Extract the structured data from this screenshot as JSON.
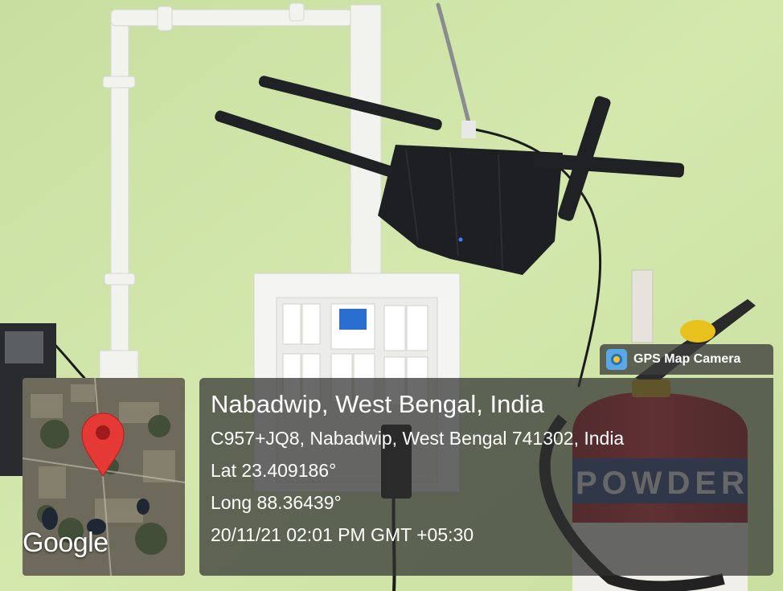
{
  "badge": {
    "app_name": "GPS Map Camera",
    "icon": "camera-map-icon"
  },
  "map": {
    "logo": "Google",
    "pin_icon": "map-pin-icon",
    "pin_color": "#e53935"
  },
  "location": {
    "place": "Nabadwip, West Bengal, India",
    "address": "C957+JQ8, Nabadwip, West Bengal 741302, India",
    "latitude": "Lat 23.409186°",
    "longitude": "Long 88.36439°",
    "timestamp": "20/11/21 02:01 PM GMT +05:30"
  },
  "photo": {
    "extinguisher_label": "POWDER",
    "colors": {
      "wall": "#cfe3a6",
      "extinguisher": "#c8252f",
      "router": "#1e1f22"
    }
  }
}
